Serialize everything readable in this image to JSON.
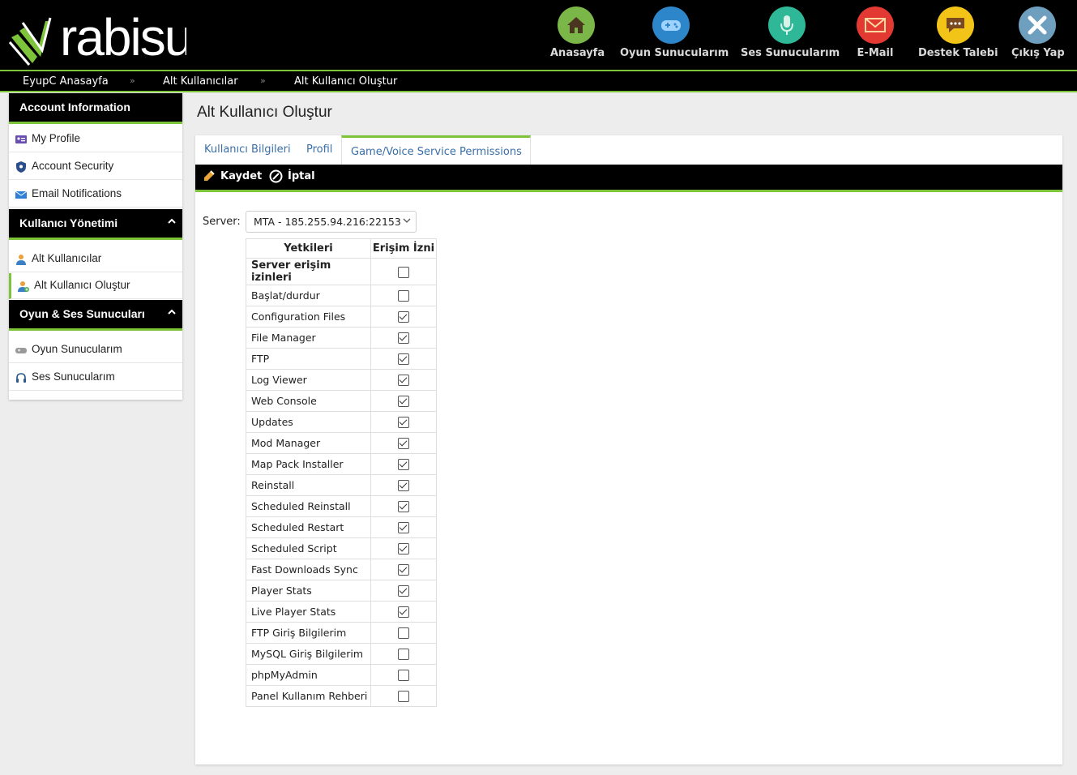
{
  "header": {
    "brand": "rabisu",
    "nav": [
      {
        "label": "Anasayfa",
        "icon": "home-icon",
        "color": "#7ab648"
      },
      {
        "label": "Oyun Sunucularım",
        "icon": "gamepad-icon",
        "color": "#2d86c9"
      },
      {
        "label": "Ses Sunucularım",
        "icon": "microphone-icon",
        "color": "#2fb898"
      },
      {
        "label": "E-Mail",
        "icon": "mail-icon",
        "color": "#e23a32"
      },
      {
        "label": "Destek Talebi",
        "icon": "chat-icon",
        "color": "#f2c417"
      },
      {
        "label": "Çıkış Yap",
        "icon": "close-icon",
        "color": "#6f9fbf"
      }
    ]
  },
  "breadcrumb": {
    "items": [
      "EyupC Anasayfa",
      "Alt Kullanıcılar",
      "Alt Kullanıcı Oluştur"
    ],
    "separator": "»"
  },
  "sidebar": {
    "sections": [
      {
        "title": "Account Information",
        "items": [
          "My Profile",
          "Account Security",
          "Email Notifications"
        ]
      },
      {
        "title": "Kullanıcı Yönetimi",
        "items": [
          "Alt Kullanıcılar",
          "Alt Kullanıcı Oluştur"
        ]
      },
      {
        "title": "Oyun & Ses Sunucuları",
        "items": [
          "Oyun Sunucularım",
          "Ses Sunucularım"
        ]
      }
    ]
  },
  "main": {
    "title": "Alt Kullanıcı Oluştur",
    "tabs": [
      "Kullanıcı Bilgileri",
      "Profil",
      "Game/Voice Service Permissions"
    ],
    "active_tab": "Game/Voice Service Permissions",
    "toolbar": {
      "save": "Kaydet",
      "cancel": "İptal"
    },
    "server": {
      "label": "Server:",
      "selected": "MTA - 185.255.94.216:22153"
    },
    "table": {
      "headers": [
        "Yetkileri",
        "Erişim İzni"
      ],
      "rows": [
        {
          "name": "Server erişim izinleri",
          "checked": false
        },
        {
          "name": "Başlat/durdur",
          "checked": false
        },
        {
          "name": "Configuration Files",
          "checked": true
        },
        {
          "name": "File Manager",
          "checked": true
        },
        {
          "name": "FTP",
          "checked": true
        },
        {
          "name": "Log Viewer",
          "checked": true
        },
        {
          "name": "Web Console",
          "checked": true
        },
        {
          "name": "Updates",
          "checked": true
        },
        {
          "name": "Mod Manager",
          "checked": true
        },
        {
          "name": "Map Pack Installer",
          "checked": true
        },
        {
          "name": "Reinstall",
          "checked": true
        },
        {
          "name": "Scheduled Reinstall",
          "checked": true
        },
        {
          "name": "Scheduled Restart",
          "checked": true
        },
        {
          "name": "Scheduled Script",
          "checked": true
        },
        {
          "name": "Fast Downloads Sync",
          "checked": true
        },
        {
          "name": "Player Stats",
          "checked": true
        },
        {
          "name": "Live Player Stats",
          "checked": true
        },
        {
          "name": "FTP Giriş Bilgilerim",
          "checked": false
        },
        {
          "name": "MySQL Giriş Bilgilerim",
          "checked": false
        },
        {
          "name": "phpMyAdmin",
          "checked": false
        },
        {
          "name": "Panel Kullanım Rehberi",
          "checked": false
        }
      ]
    }
  }
}
